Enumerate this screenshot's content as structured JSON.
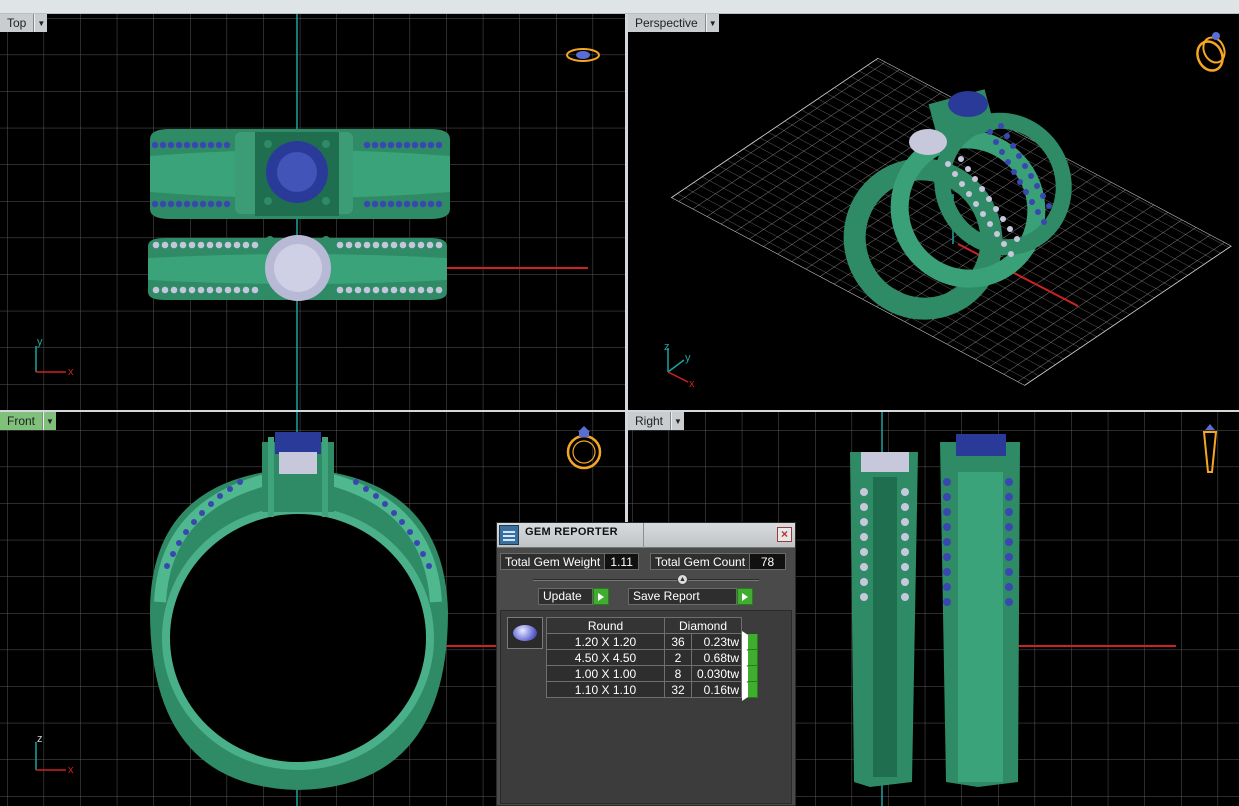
{
  "viewports": {
    "top": {
      "label": "Top"
    },
    "perspective": {
      "label": "Perspective"
    },
    "front": {
      "label": "Front"
    },
    "right": {
      "label": "Right"
    }
  },
  "axes": {
    "top": [
      "y",
      "x"
    ],
    "perspective": [
      "z",
      "y",
      "x"
    ],
    "front": [
      "z",
      "x"
    ]
  },
  "colors": {
    "viewport_bg": "#000000",
    "grid": "#555555",
    "model_metal": "#2f8f6a",
    "blue_gem": "#2a3a99",
    "white_gem": "#c8c8dc",
    "axis_x": "#cc2222",
    "axis_y": "#1aa3a3",
    "active_tab": "#7fc07a",
    "nav_icon": "#f5a623"
  },
  "gem_reporter": {
    "title": "GEM REPORTER",
    "total_weight_label": "Total Gem Weight",
    "total_weight_value": "1.11",
    "total_count_label": "Total Gem Count",
    "total_count_value": "78",
    "update_label": "Update",
    "save_report_label": "Save Report",
    "columns": {
      "shape": "Round",
      "material": "Diamond"
    },
    "rows": [
      {
        "size": "1.20 X 1.20",
        "count": "36",
        "weight": "0.23tw"
      },
      {
        "size": "4.50 X 4.50",
        "count": "2",
        "weight": "0.68tw"
      },
      {
        "size": "1.00 X 1.00",
        "count": "8",
        "weight": "0.030tw"
      },
      {
        "size": "1.10 X 1.10",
        "count": "32",
        "weight": "0.16tw"
      }
    ]
  },
  "icons": {
    "viewport_menu": "chevron-down-icon",
    "close": "close-icon",
    "run": "play-arrow-icon",
    "view_cube": "ring-view-icon"
  }
}
